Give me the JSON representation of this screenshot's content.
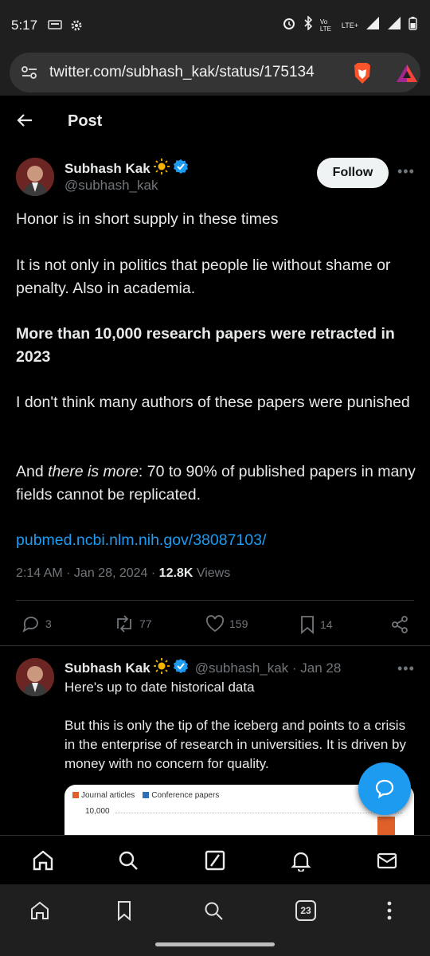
{
  "status_bar": {
    "time": "5:17",
    "network": "Vo LTE",
    "lte": "LTE+"
  },
  "browser": {
    "url": "twitter.com/subhash_kak/status/175134"
  },
  "header": {
    "title": "Post"
  },
  "tweet": {
    "author_name": "Subhash Kak",
    "handle": "@subhash_kak",
    "follow_label": "Follow",
    "paragraphs": {
      "p1": "Honor is in short supply in these times",
      "p2": "It is not only in politics that people lie without shame or penalty. Also in academia.",
      "p3": "More than 10,000 research papers were retracted in 2023",
      "p4": "I don't think many authors of these papers were punished",
      "p5_pre": "And ",
      "p5_italic": "there is more",
      "p5_post": ": 70 to 90% of published papers in many fields cannot be replicated.",
      "link": "pubmed.ncbi.nlm.nih.gov/38087103/"
    },
    "time": "2:14 AM",
    "date": "Jan 28, 2024",
    "views_count": "12.8K",
    "views_label": "Views",
    "stats": {
      "replies": "3",
      "reposts": "77",
      "likes": "159",
      "bookmarks": "14"
    }
  },
  "reply": {
    "author_name": "Subhash Kak",
    "handle_date": "@subhash_kak · Jan 28",
    "line1": "Here's up to date historical data",
    "line2": "But this is only the tip of the iceberg and points to a crisis in the enterprise of research in universities. It is driven by money  with no concern for quality.",
    "chart": {
      "legend_a": "Journal articles",
      "legend_b": "Conference papers",
      "ytick": "10,000"
    }
  },
  "browser_nav": {
    "tab_count": "23"
  },
  "colors": {
    "accent": "#1d9bf0",
    "background": "#000000",
    "text": "#e7e9ea",
    "muted": "#71767b",
    "journal": "#e0602a",
    "conference": "#2f6fb8"
  }
}
